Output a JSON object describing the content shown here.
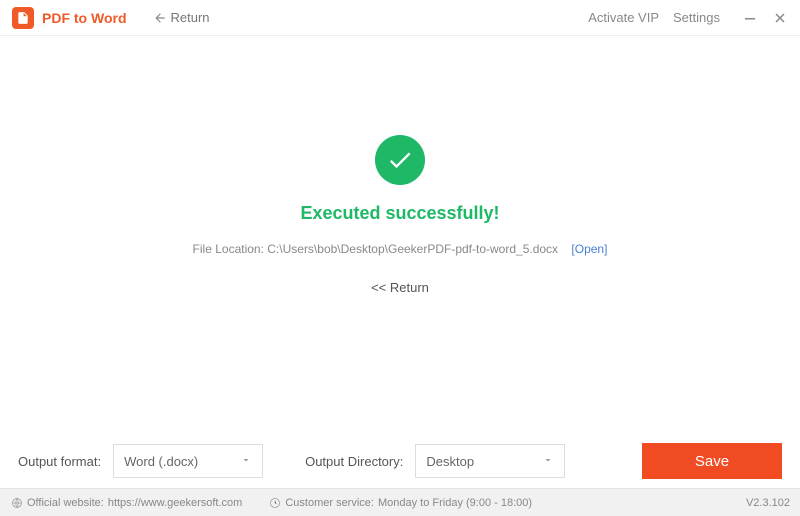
{
  "titlebar": {
    "app_title": "PDF to Word",
    "return_label": "Return",
    "activate_vip": "Activate VIP",
    "settings": "Settings"
  },
  "main": {
    "success_title": "Executed successfully!",
    "file_location_label": "File Location:",
    "file_location_path": "C:\\Users\\bob\\Desktop\\GeekerPDF-pdf-to-word_5.docx",
    "open_label": "[Open]",
    "return_link": "<< Return"
  },
  "bottom": {
    "output_format_label": "Output format:",
    "output_format_value": "Word (.docx)",
    "output_directory_label": "Output Directory:",
    "output_directory_value": "Desktop",
    "save_label": "Save"
  },
  "status": {
    "website_label": "Official website:",
    "website_url": "https://www.geekersoft.com",
    "customer_service_label": "Customer service:",
    "customer_service_hours": "Monday to Friday (9:00 - 18:00)",
    "version": "V2.3.102"
  }
}
